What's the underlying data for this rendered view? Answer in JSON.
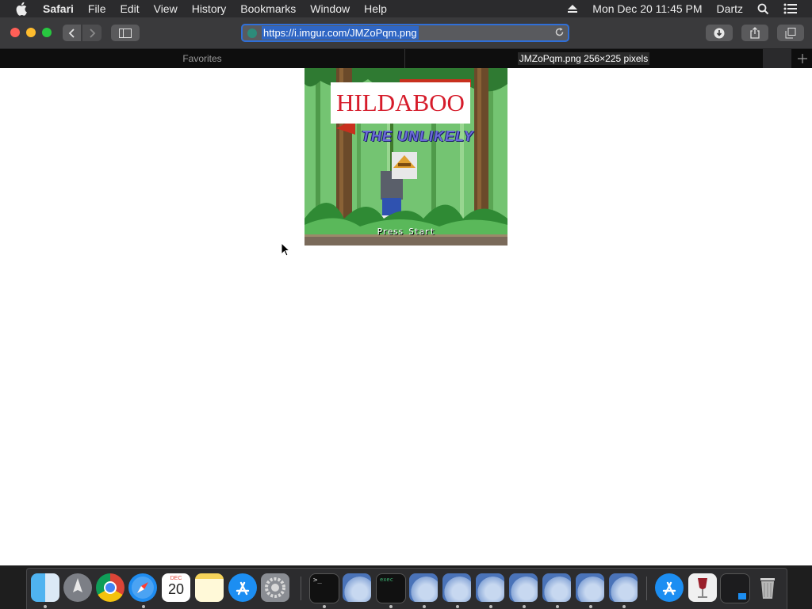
{
  "menubar": {
    "app": "Safari",
    "items": [
      "File",
      "Edit",
      "View",
      "History",
      "Bookmarks",
      "Window",
      "Help"
    ],
    "datetime": "Mon Dec 20  11:45 PM",
    "user": "Dartz"
  },
  "toolbar": {
    "url": "https://i.imgur.com/JMZoPqm.png"
  },
  "tabs": {
    "favorites": "Favorites",
    "current": "JMZoPqm.png 256×225 pixels"
  },
  "page": {
    "caption": "HILDABOO",
    "subtitle": "THE UNLIKELY",
    "press_start": "Press Start"
  },
  "dock": {
    "calendar_month": "DEC",
    "calendar_day": "20",
    "terminal_prompt": ">_",
    "exec_label": "exec"
  }
}
